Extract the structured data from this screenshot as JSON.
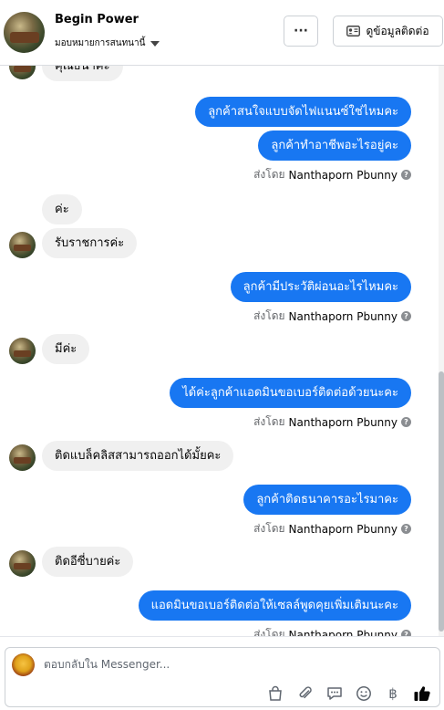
{
  "header": {
    "page_name": "Begin Power",
    "assign_label": "มอบหมายการสนทนานี้",
    "more_label": "···",
    "contact_label": "ดูข้อมูลติดต่อ"
  },
  "conversation": {
    "partial_top_message": "คุณธนาคะ",
    "messages": [
      {
        "text": "ลูกค้าสนใจแบบจัดไฟแนนซ์ใช่ไหมคะ"
      },
      {
        "text": "ลูกค้าทำอาชีพอะไรอยู่คะ"
      },
      {
        "text": "ค่ะ"
      },
      {
        "text": "รับราชการค่ะ"
      },
      {
        "text": "ลูกค้ามีประวัติผ่อนอะไรไหมคะ"
      },
      {
        "text": "มีค่ะ"
      },
      {
        "text": "ได้ค่ะลูกค้าแอดมินขอเบอร์ติดต่อด้วยนะคะ"
      },
      {
        "text": "ติดแบล็คลิสสามารถออกได้มั้ยคะ"
      },
      {
        "text": "ลูกค้าติดธนาคารอะไรมาคะ"
      },
      {
        "text": "ติดอีซี่บายค่ะ"
      },
      {
        "text": "แอดมินขอเบอร์ติดต่อให้เซลล์พูดคุยเพิ่มเติมนะคะ"
      }
    ],
    "sent_by_prefix": "ส่งโดย",
    "sender_name": "Nanthaporn Pbunny",
    "info_icon": "?"
  },
  "composer": {
    "placeholder": "ตอบกลับใน Messenger...",
    "tools": {
      "shop": "shopping-bag-icon",
      "attach": "paperclip-icon",
      "saved_replies": "chat-bubble-icon",
      "emoji": "emoji-icon",
      "payment": "baht-icon",
      "like": "thumbs-up-icon"
    },
    "baht_symbol": "฿"
  },
  "colors": {
    "accent": "#1877f2",
    "incoming_bubble": "#f0f0f0",
    "secondary_text": "#65676b"
  }
}
